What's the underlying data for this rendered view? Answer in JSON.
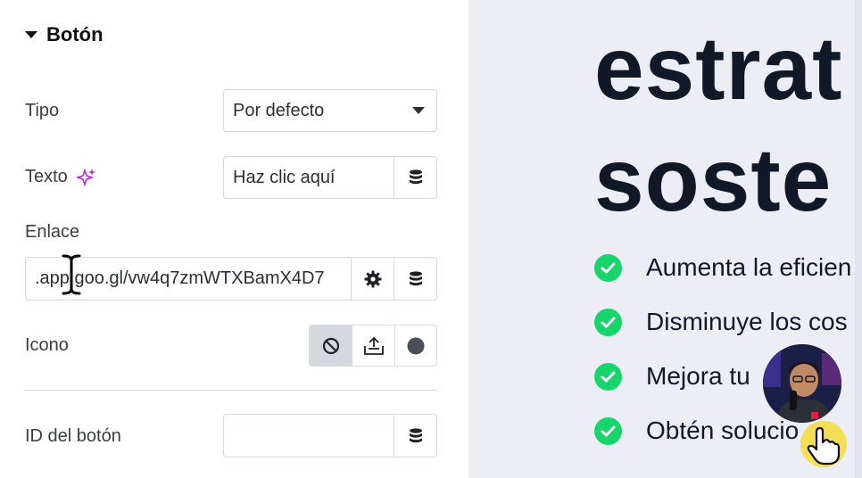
{
  "panel": {
    "section_title": "Botón",
    "tipo": {
      "label": "Tipo",
      "value": "Por defecto"
    },
    "texto": {
      "label": "Texto",
      "value": "Haz clic aquí"
    },
    "enlace": {
      "label": "Enlace",
      "value": ".app.goo.gl/vw4q7zmWTXBamX4D7"
    },
    "icono": {
      "label": "Icono"
    },
    "id_boton": {
      "label": "ID del botón",
      "value": ""
    }
  },
  "preview": {
    "heading_line1": "estrat",
    "heading_line2": "soste",
    "bullets": [
      "Aumenta la eficien",
      "Disminuye los cos",
      "Mejora tu",
      "Obtén solucio"
    ]
  },
  "colors": {
    "accent_green": "#17d46b",
    "heading": "#111827",
    "preview_bg": "#ecedf5",
    "ai_sparkle": "#c026d3"
  }
}
